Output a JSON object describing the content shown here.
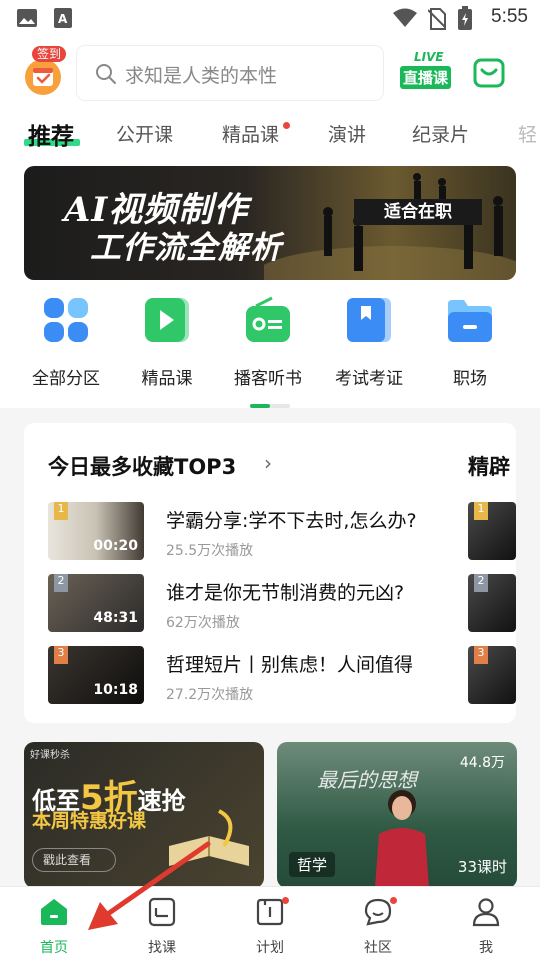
{
  "status_bar": {
    "time": "5:55",
    "icons": [
      "gallery-icon",
      "a-notification-icon",
      "wifi-icon",
      "no-sim-icon",
      "battery-icon"
    ]
  },
  "header": {
    "sign_in_badge": "签到",
    "search_placeholder": "求知是人类的本性",
    "live_tag": "LIVE",
    "live_label": "直播课"
  },
  "tabs": [
    {
      "label": "推荐",
      "active": true
    },
    {
      "label": "公开课",
      "active": false
    },
    {
      "label": "精品课",
      "active": false,
      "dot": true
    },
    {
      "label": "演讲",
      "active": false
    },
    {
      "label": "纪录片",
      "active": false
    },
    {
      "label": "轻",
      "active": false
    }
  ],
  "banner": {
    "line1": "AI视频制作",
    "line2": "工作流全解析",
    "tag": "适合在职"
  },
  "categories": [
    {
      "label": "全部分区",
      "icon": "grid-icon",
      "color": "#3b8cf5"
    },
    {
      "label": "精品课",
      "icon": "play-icon",
      "color": "#2fc768"
    },
    {
      "label": "播客听书",
      "icon": "radio-icon",
      "color": "#2fc768"
    },
    {
      "label": "考试考证",
      "icon": "bookmark-icon",
      "color": "#3b8cf5"
    },
    {
      "label": "职场",
      "icon": "folder-icon",
      "color": "#3b8cf5"
    }
  ],
  "top3": {
    "title": "今日最多收藏TOP3",
    "next_title": "精辟",
    "items": [
      {
        "rank": "1",
        "title": "学霸分享:学不下去时,怎么办?",
        "plays": "25.5万次播放",
        "duration": "00:20"
      },
      {
        "rank": "2",
        "title": "谁才是你无节制消费的元凶?",
        "plays": "62万次播放",
        "duration": "48:31"
      },
      {
        "rank": "3",
        "title": "哲理短片丨别焦虑！人间值得",
        "plays": "27.2万次播放",
        "duration": "10:18"
      }
    ]
  },
  "promos": {
    "left": {
      "tag": "好课秒杀",
      "prefix": "低至",
      "discount": "5折",
      "suffix": "速抢",
      "subtitle": "本周特惠好课",
      "button": "戳此查看"
    },
    "right": {
      "views": "44.8万",
      "subject": "哲学",
      "lessons": "33课时"
    }
  },
  "bottom_nav": [
    {
      "label": "首页",
      "icon": "home-icon",
      "active": true
    },
    {
      "label": "找课",
      "icon": "find-course-icon",
      "active": false
    },
    {
      "label": "计划",
      "icon": "plan-icon",
      "active": false,
      "dot": true
    },
    {
      "label": "社区",
      "icon": "community-icon",
      "active": false,
      "dot": true
    },
    {
      "label": "我",
      "icon": "profile-icon",
      "active": false
    }
  ],
  "colors": {
    "accent": "#1bb85a",
    "dot": "#e8453c",
    "arrow": "#e03a2f"
  }
}
